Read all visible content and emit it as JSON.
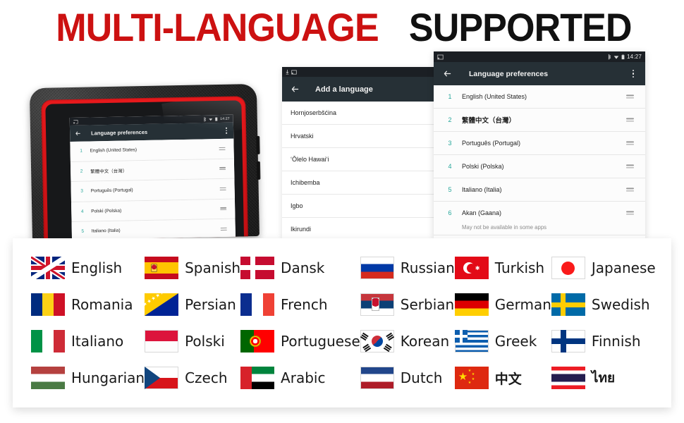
{
  "headline": {
    "red_part": "MULTI-LANGUAGE",
    "black_part": "SUPPORTED"
  },
  "tablet_screen": {
    "status_bar": {
      "time": "14:27",
      "icons": [
        "cast-icon",
        "bluetooth-icon",
        "wifi-icon",
        "battery-icon"
      ]
    },
    "app_bar": {
      "back_icon": "back-arrow-icon",
      "title": "Language preferences",
      "overflow_icon": "kebab-menu-icon"
    },
    "languages": [
      {
        "num": "1",
        "name": "English (United States)"
      },
      {
        "num": "2",
        "name": "繁體中文（台灣）"
      },
      {
        "num": "3",
        "name": "Português (Portugal)"
      },
      {
        "num": "4",
        "name": "Polski (Polska)"
      },
      {
        "num": "5",
        "name": "Italiano (Italia)"
      }
    ]
  },
  "add_language_panel": {
    "status_bar": {
      "icons": [
        "download-icon",
        "cast-icon"
      ]
    },
    "app_bar": {
      "back_icon": "back-arrow-icon",
      "title": "Add a language"
    },
    "languages": [
      {
        "name": "Hornjoserbšćina"
      },
      {
        "name": "Hrvatski"
      },
      {
        "name": "ʻŌlelo Hawaiʻi"
      },
      {
        "name": "Ichibemba"
      },
      {
        "name": "Igbo"
      },
      {
        "name": "Ikirundi"
      }
    ]
  },
  "language_prefs_panel": {
    "status_bar": {
      "time": "14:27",
      "icons": [
        "cast-icon",
        "bluetooth-icon",
        "wifi-icon",
        "battery-icon"
      ]
    },
    "app_bar": {
      "back_icon": "back-arrow-icon",
      "title": "Language preferences",
      "overflow_icon": "kebab-menu-icon"
    },
    "languages": [
      {
        "num": "1",
        "name": "English (United States)",
        "bold": false,
        "sub": ""
      },
      {
        "num": "2",
        "name": "繁體中文（台灣）",
        "bold": true,
        "sub": ""
      },
      {
        "num": "3",
        "name": "Português (Portugal)",
        "bold": false,
        "sub": ""
      },
      {
        "num": "4",
        "name": "Polski (Polska)",
        "bold": false,
        "sub": ""
      },
      {
        "num": "5",
        "name": "Italiano (Italia)",
        "bold": false,
        "sub": ""
      },
      {
        "num": "6",
        "name": "Akan (Gaana)",
        "bold": false,
        "sub": "May not be available in some apps"
      }
    ]
  },
  "flag_panel": {
    "flags": [
      {
        "label": "English",
        "flag": "united-kingdom-flag"
      },
      {
        "label": "Spanish",
        "flag": "spain-flag"
      },
      {
        "label": "Dansk",
        "flag": "denmark-flag"
      },
      {
        "label": "Russian",
        "flag": "russia-flag"
      },
      {
        "label": "Turkish",
        "flag": "turkey-flag"
      },
      {
        "label": "Japanese",
        "flag": "japan-flag"
      },
      {
        "label": "Romania",
        "flag": "romania-flag"
      },
      {
        "label": "Persian",
        "flag": "bosnia-flag"
      },
      {
        "label": "French",
        "flag": "france-flag"
      },
      {
        "label": "Serbian",
        "flag": "serbia-flag"
      },
      {
        "label": "German",
        "flag": "germany-flag"
      },
      {
        "label": "Swedish",
        "flag": "sweden-flag"
      },
      {
        "label": "Italiano",
        "flag": "italy-flag"
      },
      {
        "label": "Polski",
        "flag": "poland-flag"
      },
      {
        "label": "Portuguese",
        "flag": "portugal-flag"
      },
      {
        "label": "Korean",
        "flag": "south-korea-flag"
      },
      {
        "label": "Greek",
        "flag": "greece-flag"
      },
      {
        "label": "Finnish",
        "flag": "finland-flag"
      },
      {
        "label": "Hungarian",
        "flag": "hungary-flag"
      },
      {
        "label": "Czech",
        "flag": "czech-republic-flag"
      },
      {
        "label": "Arabic",
        "flag": "uae-flag"
      },
      {
        "label": "Dutch",
        "flag": "netherlands-flag"
      },
      {
        "label": "中文",
        "flag": "china-flag"
      },
      {
        "label": "ไทย",
        "flag": "thailand-flag"
      }
    ]
  },
  "colors": {
    "headline_red": "#cc1111",
    "headline_black": "#111111",
    "appbar": "#263036",
    "accent_teal": "#26a69a",
    "bezel_red": "#e8191c"
  }
}
